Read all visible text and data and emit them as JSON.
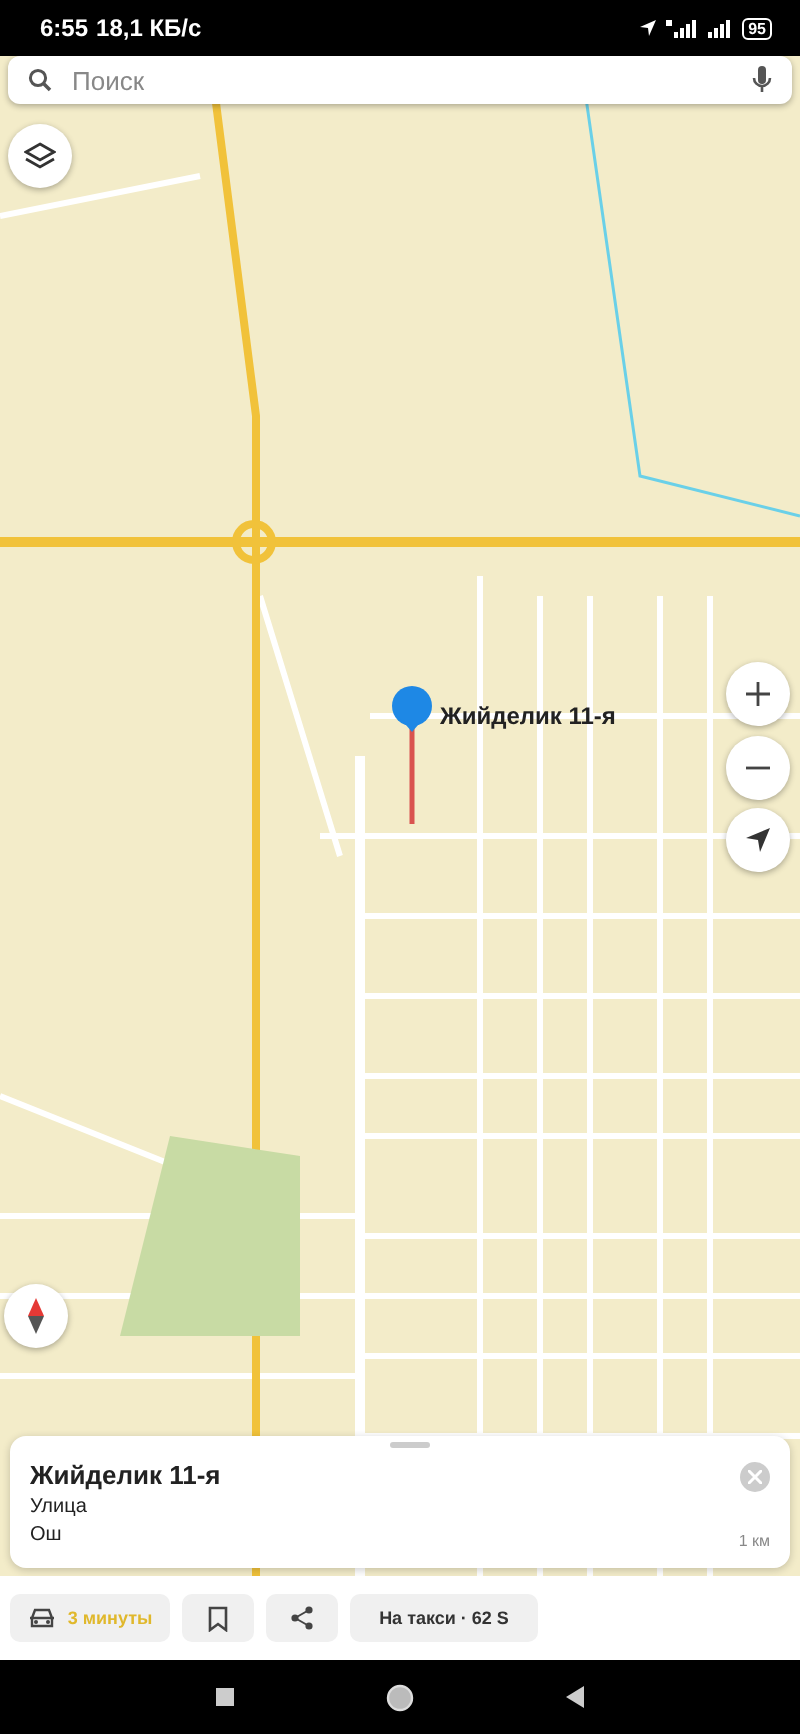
{
  "status_bar": {
    "time": "6:55",
    "speed": "18,1 КБ/с",
    "battery": "95"
  },
  "search": {
    "placeholder": "Поиск"
  },
  "map": {
    "pin_label": "Жийделик 11-я"
  },
  "place_card": {
    "title": "Жийделик 11-я",
    "type": "Улица",
    "city": "Ош",
    "distance": "1 км"
  },
  "actions": {
    "route_time": "3 минуты",
    "taxi": "На такси · 62 S"
  }
}
